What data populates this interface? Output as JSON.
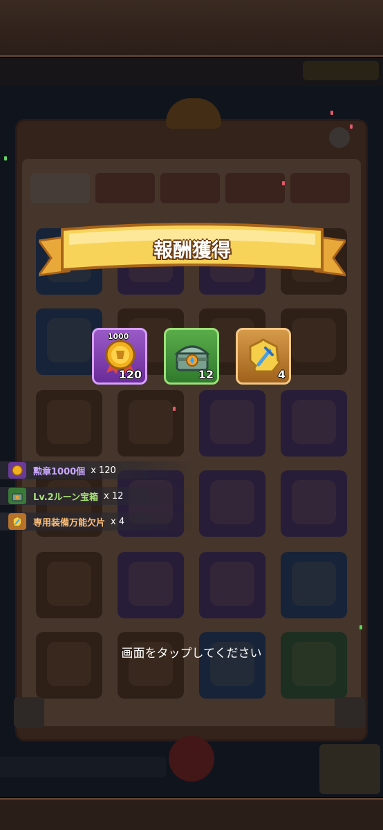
{
  "ribbon": {
    "title": "報酬獲得"
  },
  "tiles": [
    {
      "name": "medal-1000",
      "top_label": "1000",
      "qty": "120",
      "icon": "gold-medal-icon"
    },
    {
      "name": "rune-chest",
      "top_label": "",
      "qty": "12",
      "icon": "green-chest-icon"
    },
    {
      "name": "equipment-shard",
      "top_label": "",
      "qty": "4",
      "icon": "puzzle-shard-icon"
    }
  ],
  "reward_list": [
    {
      "name": "勲章1000個",
      "count": "x 120",
      "color": "#c9a8ff",
      "icon": "gold-medal-icon"
    },
    {
      "name": "Lv.2ルーン宝箱",
      "count": "x 12",
      "color": "#a8e07a",
      "icon": "green-chest-icon"
    },
    {
      "name": "専用装備万能欠片",
      "count": "x 4",
      "color": "#ffc07a",
      "icon": "puzzle-shard-icon"
    }
  ],
  "tap_hint": "画面をタップしてください"
}
